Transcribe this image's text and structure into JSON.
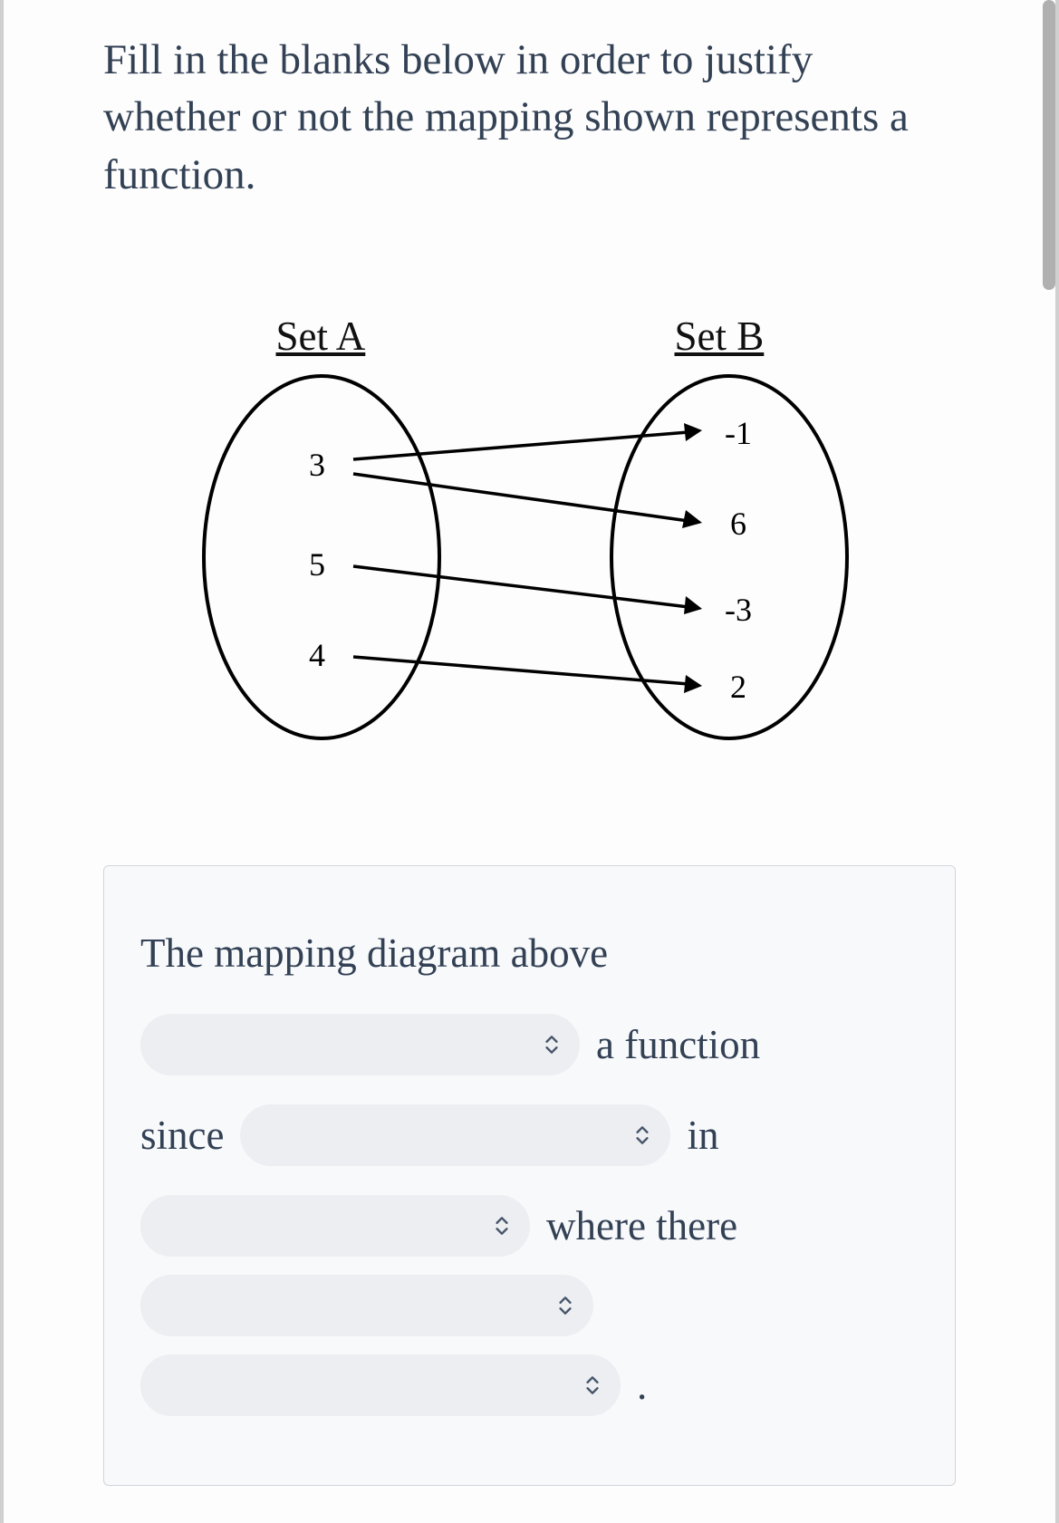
{
  "question": "Fill in the blanks below in order to justify whether or not the mapping shown represents a function.",
  "diagram": {
    "setA_label": "Set A",
    "setB_label": "Set B",
    "setA_values": [
      "3",
      "5",
      "4"
    ],
    "setB_values": [
      "-1",
      "6",
      "-3",
      "2"
    ],
    "arrows": [
      {
        "from": "3",
        "to": "-1"
      },
      {
        "from": "3",
        "to": "6"
      },
      {
        "from": "5",
        "to": "-3"
      },
      {
        "from": "4",
        "to": "2"
      }
    ]
  },
  "answer": {
    "line1_prefix": "The mapping diagram above",
    "line2_suffix": "a function",
    "line3_prefix": "since",
    "line3_suffix": "in",
    "line4_suffix": "where there",
    "line6_suffix": "."
  },
  "dropdowns": {
    "d0": "",
    "d1": "",
    "d2": "",
    "d3": "",
    "d4": ""
  }
}
